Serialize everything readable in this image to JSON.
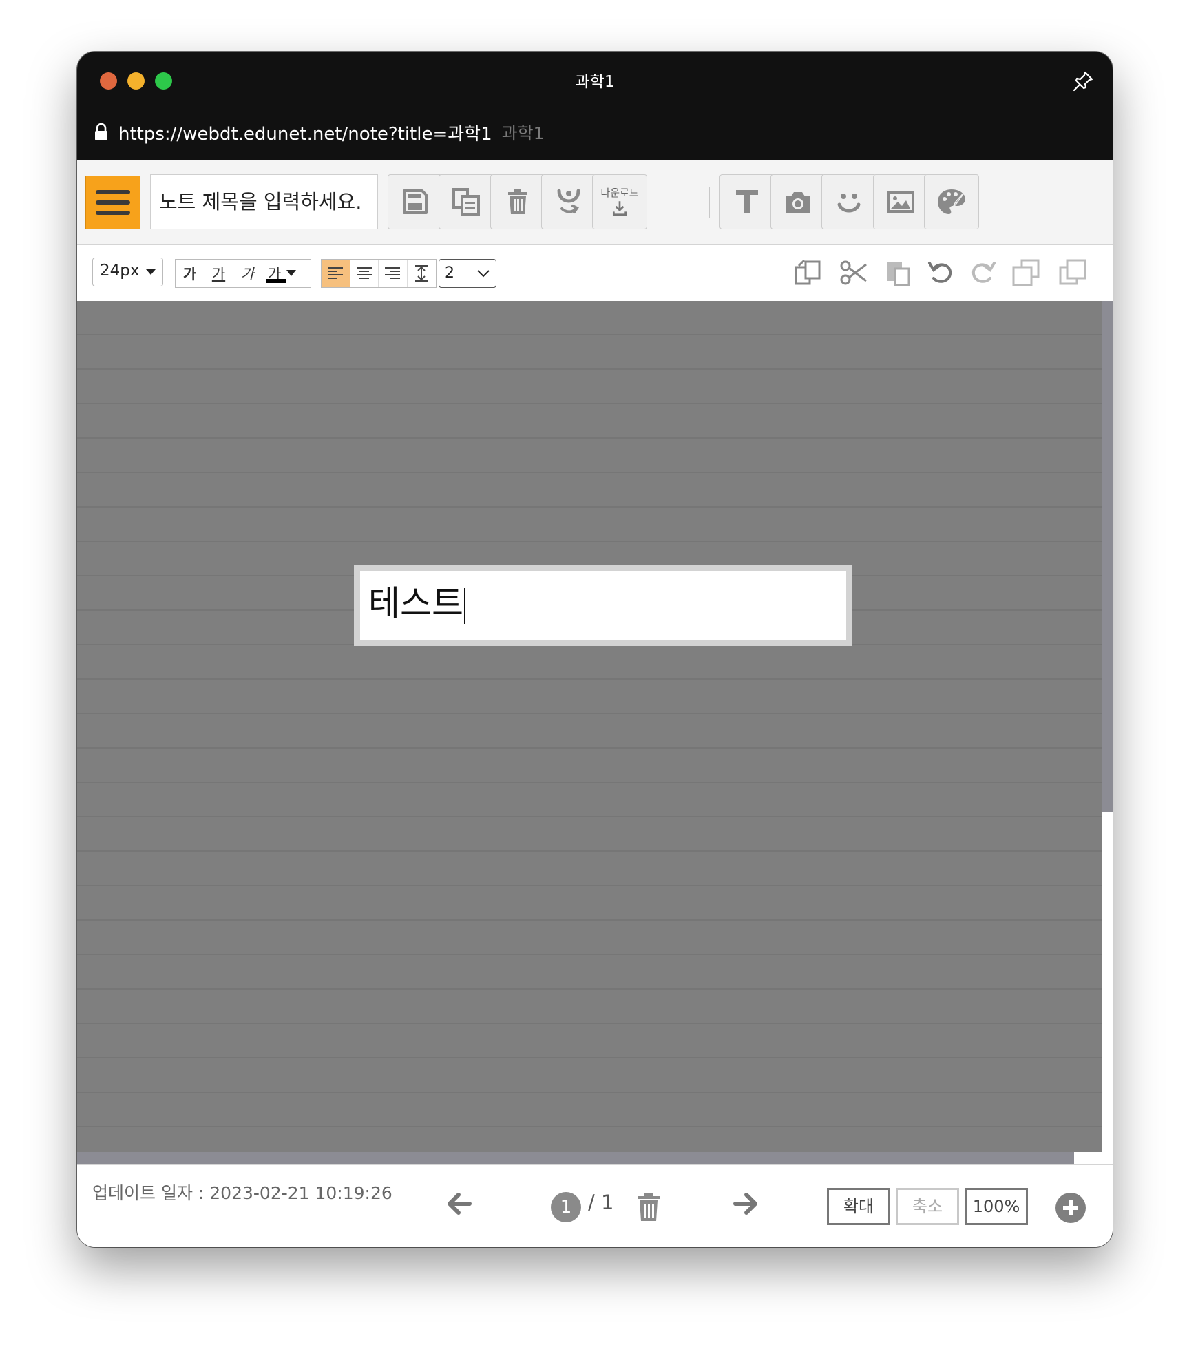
{
  "window": {
    "title": "과학1"
  },
  "address_bar": {
    "url": "https://webdt.edunet.net/note?title=과학1",
    "page_title": "과학1"
  },
  "toolbar": {
    "title_input": {
      "placeholder": "노트 제목을 입력하세요.",
      "value": ""
    },
    "download_label": "다운로드",
    "buttons": [
      "menu-icon",
      "save-icon",
      "copy-note-icon",
      "trash-icon",
      "share-icon",
      "download-icon",
      "text-icon",
      "camera-icon",
      "sticker-icon",
      "image-icon",
      "palette-icon"
    ]
  },
  "format_bar": {
    "font_size": "24px",
    "styles": {
      "bold": "가",
      "underline": "가",
      "italic": "가",
      "color": "가"
    },
    "text_color": "#000000",
    "active_align": "left",
    "line_spacing": "2",
    "edit_buttons": [
      "duplicate-icon",
      "cut-icon",
      "paste-icon",
      "undo-icon",
      "redo-icon",
      "bring-forward-icon",
      "send-backward-icon"
    ]
  },
  "canvas": {
    "text_box": {
      "text": "테스트"
    }
  },
  "footer": {
    "updated": "업데이트 일자 : 2023-02-21 10:19:26",
    "current_page": "1",
    "total_pages": "/ 1",
    "zoom_in": "확대",
    "zoom_out": "축소",
    "zoom_level": "100%"
  },
  "colors": {
    "accent": "#f7a21b",
    "canvas": "#7f7f7f",
    "active_align": "#f6c07e",
    "titlebar": "#111111"
  }
}
